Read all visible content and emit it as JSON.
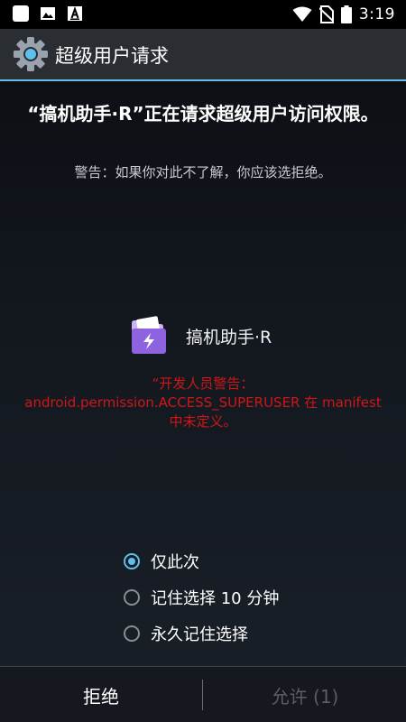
{
  "status_bar": {
    "time": "3:19",
    "left_icons": [
      "square-notification-icon",
      "image-notification-icon",
      "font-notification-icon"
    ],
    "right_icons": [
      "wifi-icon",
      "no-sim-icon",
      "battery-icon"
    ]
  },
  "title_bar": {
    "title": "超级用户请求",
    "icon": "gear-icon",
    "accent_color": "#5ec1ec"
  },
  "main": {
    "headline": "“搞机助手·R”正在请求超级用户访问权限。",
    "warning": "警告：如果你对此不了解，你应该选拒绝。",
    "app_name": "搞机助手·R",
    "app_icon": "gaoji-app-icon",
    "developer_warning": "“开发人员警告：android.permission.ACCESS_SUPERUSER 在 manifest 中未定义。",
    "developer_warning_color": "#d01616"
  },
  "options": [
    {
      "label": "仅此次",
      "selected": true
    },
    {
      "label": "记住选择 10 分钟",
      "selected": false
    },
    {
      "label": "永久记住选择",
      "selected": false
    }
  ],
  "buttons": {
    "deny": "拒绝",
    "allow": "允许 (1)"
  }
}
